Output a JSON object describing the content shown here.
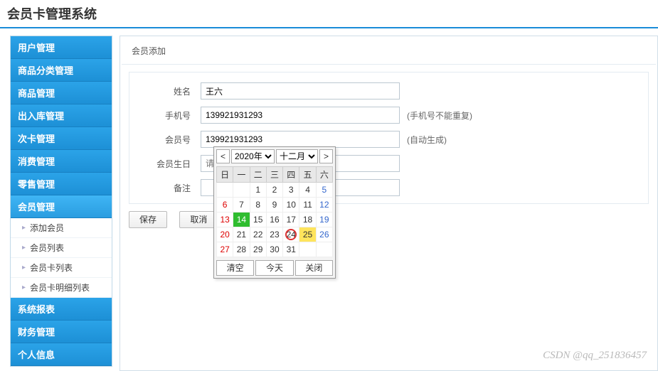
{
  "app": {
    "title": "会员卡管理系统"
  },
  "sidebar": {
    "items": [
      {
        "label": "用户管理"
      },
      {
        "label": "商品分类管理"
      },
      {
        "label": "商品管理"
      },
      {
        "label": "出入库管理"
      },
      {
        "label": "次卡管理"
      },
      {
        "label": "消费管理"
      },
      {
        "label": "零售管理"
      },
      {
        "label": "会员管理",
        "active": true,
        "children": [
          {
            "label": "添加会员"
          },
          {
            "label": "会员列表"
          },
          {
            "label": "会员卡列表"
          },
          {
            "label": "会员卡明细列表"
          }
        ]
      },
      {
        "label": "系统报表"
      },
      {
        "label": "财务管理"
      },
      {
        "label": "个人信息"
      }
    ]
  },
  "panel": {
    "title": "会员添加"
  },
  "form": {
    "name": {
      "label": "姓名",
      "value": "王六"
    },
    "phone": {
      "label": "手机号",
      "value": "139921931293",
      "hint": "(手机号不能重复)"
    },
    "memberNo": {
      "label": "会员号",
      "value": "139921931293",
      "hint": "(自动生成)"
    },
    "birthday": {
      "label": "会员生日",
      "value": "",
      "placeholder": "请输入会员生日"
    },
    "remark": {
      "label": "备注",
      "value": ""
    }
  },
  "buttons": {
    "save": "保存",
    "cancel": "取消"
  },
  "dp": {
    "prev": "<",
    "next": ">",
    "year": "2020年",
    "month": "十二月",
    "dow": [
      "日",
      "一",
      "二",
      "三",
      "四",
      "五",
      "六"
    ],
    "selected": 14,
    "today": 24,
    "clear": "清空",
    "todayBtn": "今天",
    "close": "关闭"
  },
  "watermark": "CSDN @qq_251836457"
}
